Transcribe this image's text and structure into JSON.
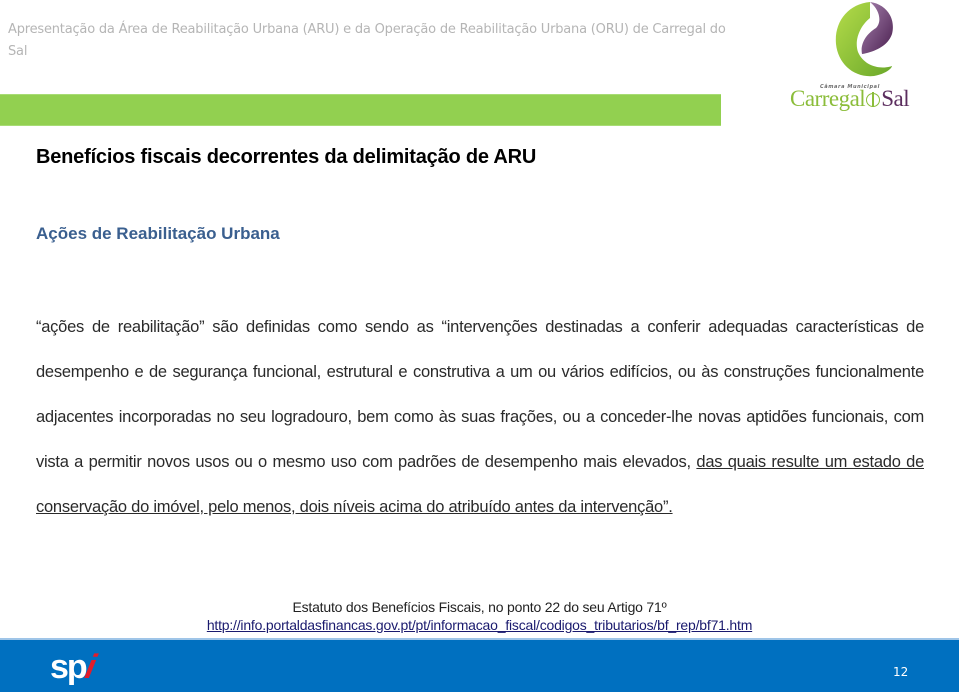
{
  "header": {
    "presentation_title": "Apresentação da Área de Reabilitação Urbana (ARU) e da Operação de Reabilitação Urbana (ORU) de Carregal do Sal",
    "accent_color": "#92d050"
  },
  "logo": {
    "small_text": "Câmara Municipal",
    "name_part1": "Carregal",
    "name_part2": "Sal",
    "emblem_colors": [
      "#8bc34a",
      "#5b2d5e"
    ]
  },
  "slide": {
    "title": "Benefícios fiscais decorrentes da delimitação de ARU",
    "subtitle": "Ações de Reabilitação Urbana",
    "subtitle_color": "#3a5f8f",
    "body": {
      "part_plain": "“ações de reabilitação” são definidas como sendo as “intervenções destinadas a conferir adequadas características de desempenho e de segurança funcional, estrutural e construtiva a um ou vários edifícios, ou às construções funcionalmente adjacentes incorporadas no seu logradouro, bem como às suas frações, ou a conceder-lhe novas aptidões funcionais, com vista a permitir novos usos ou o mesmo uso com padrões de desempenho mais elevados, ",
      "part_underlined": "das quais resulte um estado de conservação do imóvel, pelo menos, dois níveis acima do atribuído antes da intervenção”."
    },
    "citation": {
      "source": "Estatuto dos Benefícios Fiscais, no ponto 22 do seu Artigo 71º",
      "link": "http://info.portaldasfinancas.gov.pt/pt/informacao_fiscal/codigos_tributarios/bf_rep/bf71.htm"
    }
  },
  "footer": {
    "brand_main": "sp",
    "brand_accent": "i",
    "page_number": "12",
    "background_color": "#0070c0"
  }
}
